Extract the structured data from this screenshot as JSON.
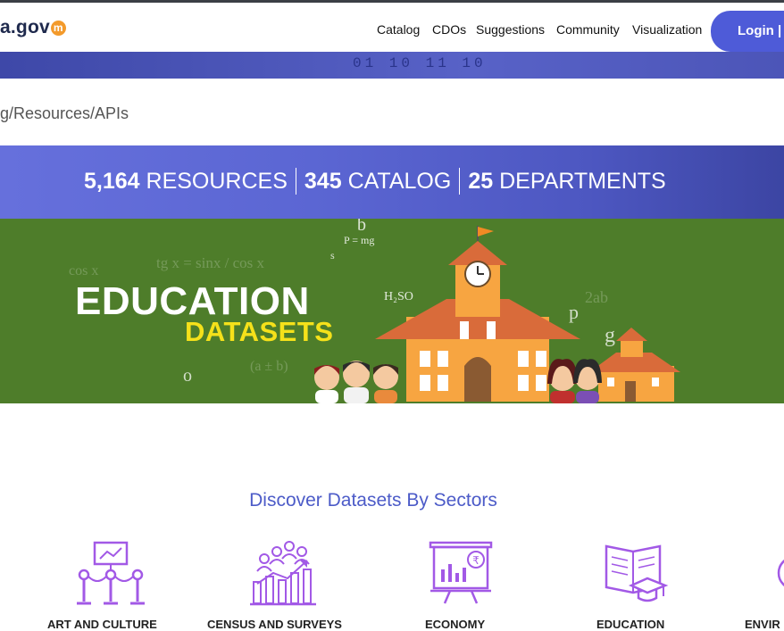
{
  "header": {
    "logo_text": "a.gov",
    "logo_mark": "m",
    "nav": [
      "Catalog",
      "CDOs",
      "Suggestions",
      "Community",
      "Visualization"
    ],
    "login_label": "Login | "
  },
  "band_digits": "01  10 11  10",
  "breadcrumb": "g/Resources/APIs",
  "stats": {
    "resources_count": "5,164",
    "resources_label": "RESOURCES",
    "catalog_count": "345",
    "catalog_label": "CATALOG",
    "departments_count": "25",
    "departments_label": "DEPARTMENTS"
  },
  "banner": {
    "title": "EDUCATION",
    "subtitle": "DATASETS",
    "formulas": {
      "f1": "P = mg",
      "f2": "H₂SO",
      "f3": "tg x = sinx / cos x",
      "f4": "(a ± b)",
      "f5": "cos x",
      "f6": "2ab",
      "f7": "p",
      "f8": "g",
      "f9": "b",
      "f10": "o",
      "f11": "s"
    }
  },
  "sectors": {
    "title": "Discover Datasets By Sectors",
    "items": [
      {
        "label": "ART AND CULTURE",
        "icon": "art-culture-icon"
      },
      {
        "label": "CENSUS AND SURVEYS",
        "icon": "census-icon"
      },
      {
        "label": "ECONOMY",
        "icon": "economy-icon"
      },
      {
        "label": "EDUCATION",
        "icon": "education-icon"
      },
      {
        "label": "ENVIR",
        "icon": "environment-icon"
      }
    ]
  },
  "colors": {
    "accent": "#4e5bd8",
    "banner_green": "#4e7d2a",
    "sector_purple": "#a259e6",
    "title_blue": "#4c5bc8"
  }
}
